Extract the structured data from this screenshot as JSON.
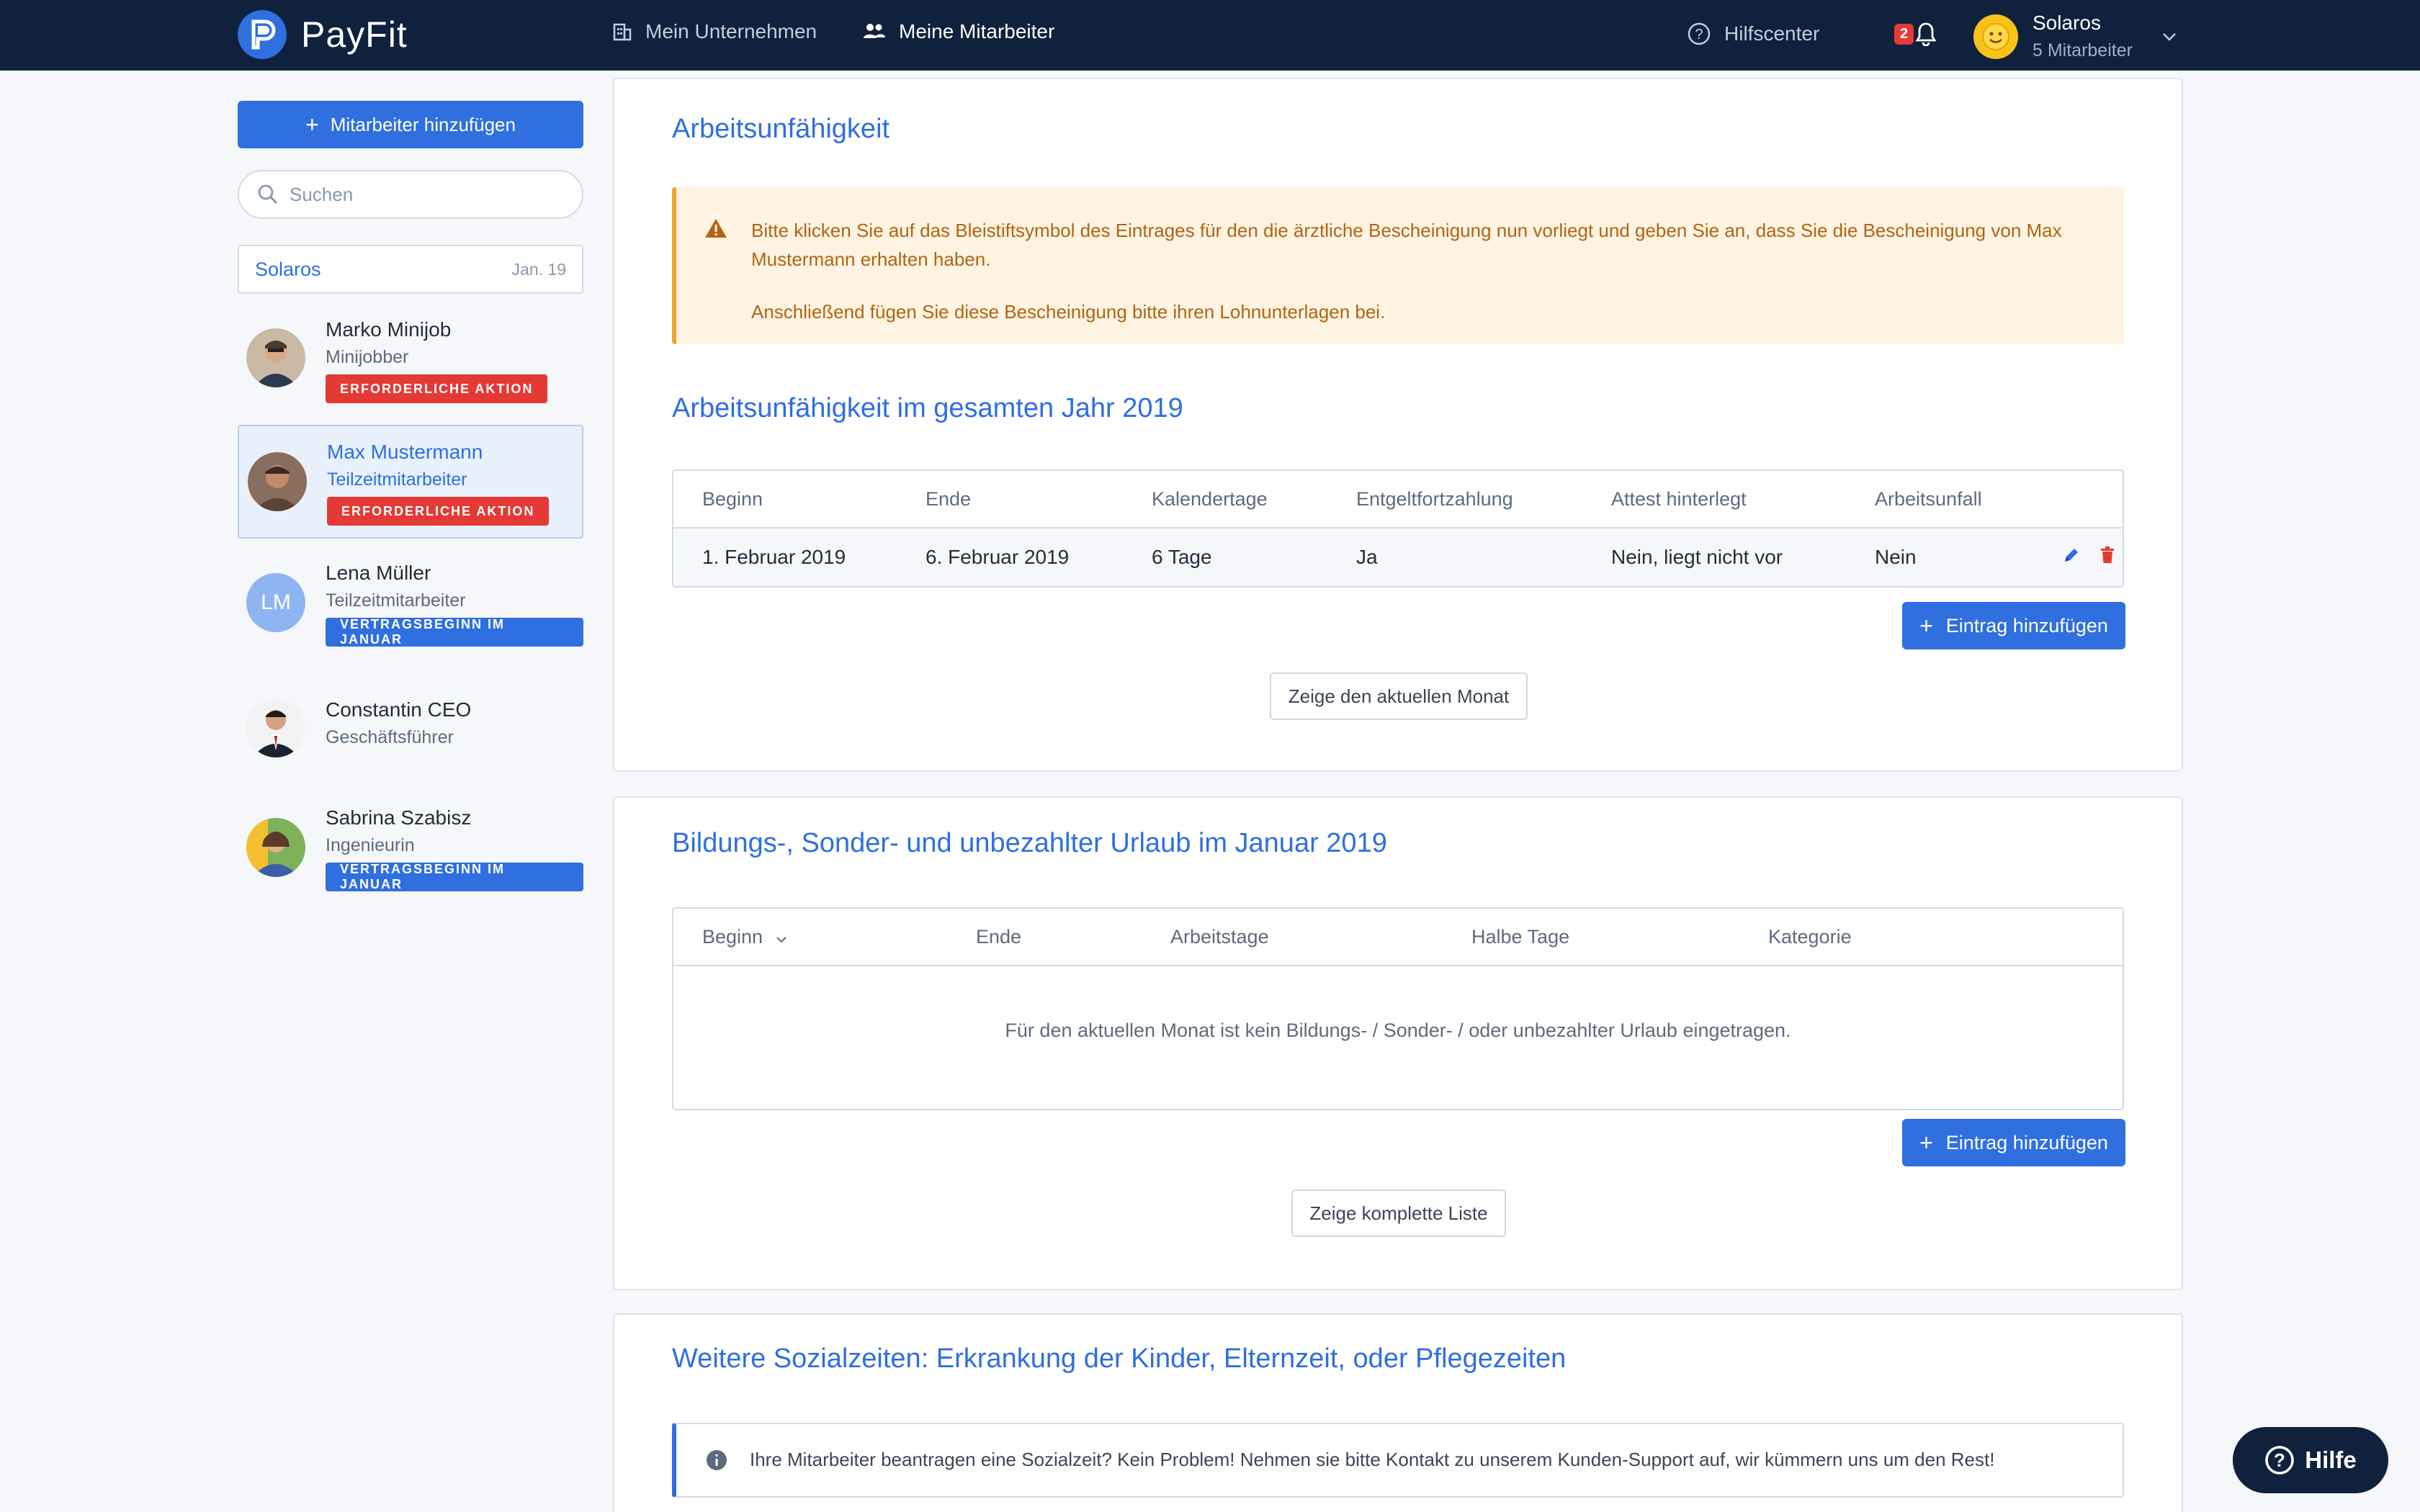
{
  "brand": {
    "name": "PayFit"
  },
  "nav": {
    "company": "Mein Unternehmen",
    "employees": "Meine Mitarbeiter",
    "help_center": "Hilfscenter",
    "notifications_count": "2"
  },
  "account": {
    "name": "Solaros",
    "sub": "5 Mitarbeiter"
  },
  "sidebar": {
    "add_button": "Mitarbeiter hinzufügen",
    "search_placeholder": "Suchen",
    "company": {
      "name": "Solaros",
      "period": "Jan. 19"
    },
    "employees": [
      {
        "name": "Marko Minijob",
        "role": "Minijobber",
        "badge": "ERFORDERLICHE AKTION",
        "badge_color": "#e53935"
      },
      {
        "name": "Max Mustermann",
        "role": "Teilzeitmitarbeiter",
        "badge": "ERFORDERLICHE AKTION",
        "badge_color": "#e53935",
        "selected": true
      },
      {
        "name": "Lena Müller",
        "role": "Teilzeitmitarbeiter",
        "badge": "VERTRAGSBEGINN IM JANUAR",
        "badge_color": "#2f6fe0",
        "initials": "LM"
      },
      {
        "name": "Constantin CEO",
        "role": "Geschäftsführer"
      },
      {
        "name": "Sabrina Szabisz",
        "role": "Ingenieurin",
        "badge": "VERTRAGSBEGINN IM JANUAR",
        "badge_color": "#2f6fe0"
      }
    ]
  },
  "incapacity": {
    "title": "Arbeitsunfähigkeit",
    "warning_line1": "Bitte klicken Sie auf das Bleistiftsymbol des Eintrages für den die ärztliche Bescheinigung nun vorliegt und geben Sie an, dass Sie die Bescheinigung von Max Mustermann erhalten haben.",
    "warning_line2": "Anschließend fügen Sie diese Bescheinigung bitte ihren Lohnunterlagen bei.",
    "year_title": "Arbeitsunfähigkeit im gesamten Jahr 2019",
    "columns": [
      "Beginn",
      "Ende",
      "Kalendertage",
      "Entgeltfortzahlung",
      "Attest hinterlegt",
      "Arbeitsunfall"
    ],
    "rows": [
      [
        "1. Februar 2019",
        "6. Februar 2019",
        "6 Tage",
        "Ja",
        "Nein, liegt nicht vor",
        "Nein"
      ]
    ],
    "add_button": "Eintrag hinzufügen",
    "show_button": "Zeige den aktuellen Monat"
  },
  "leave": {
    "title": "Bildungs-, Sonder- und unbezahlter Urlaub im Januar 2019",
    "columns": [
      "Beginn",
      "Ende",
      "Arbeitstage",
      "Halbe Tage",
      "Kategorie"
    ],
    "empty": "Für den aktuellen Monat ist kein Bildungs- / Sonder- / oder unbezahlter Urlaub eingetragen.",
    "add_button": "Eintrag hinzufügen",
    "show_button": "Zeige komplette Liste"
  },
  "social": {
    "title": "Weitere Sozialzeiten: Erkrankung der Kinder, Elternzeit, oder Pflegezeiten",
    "info": "Ihre Mitarbeiter beantragen eine Sozialzeit? Kein Problem! Nehmen sie bitte Kontakt zu unserem Kunden-Support auf, wir kümmern uns um den Rest!"
  },
  "help_bubble": "Hilfe"
}
